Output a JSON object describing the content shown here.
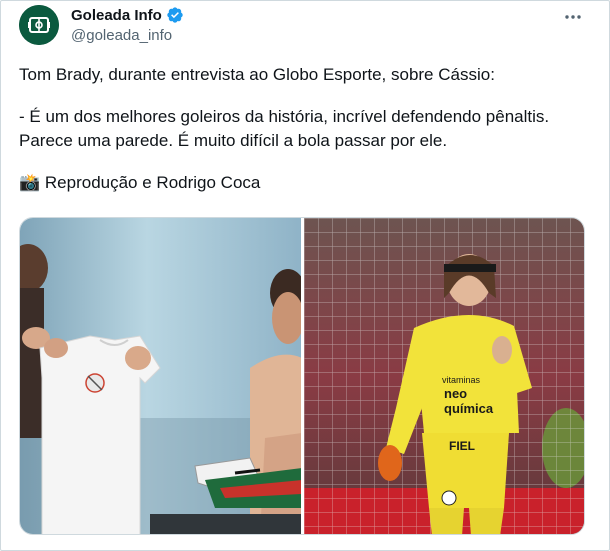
{
  "author": {
    "display_name": "Goleada Info",
    "handle": "@goleada_info",
    "avatar_icon": "goleada-logo-icon",
    "verified_icon": "verified-badge-icon",
    "verified_color": "#1d9bf0"
  },
  "more_icon": "more-dots-icon",
  "tweet": {
    "line1": "Tom Brady, durante entrevista ao Globo Esporte, sobre Cássio:",
    "line2": "- É um dos melhores goleiros da história, incrível defendendo pênaltis.",
    "line3": "Parece uma parede. É muito difícil a bola passar por ele.",
    "credit": "📸 Reprodução e Rodrigo Coca"
  },
  "media": {
    "photos": [
      {
        "name": "interview-photo",
        "jersey_text": ""
      },
      {
        "name": "goalkeeper-photo",
        "shirt_text_1": "vitaminas",
        "shirt_text_2": "neo",
        "shirt_text_3": "química",
        "shirt_text_4": "FIEL"
      }
    ]
  },
  "colors": {
    "text": "#0f1419",
    "secondary": "#536471",
    "border": "#cfd9de",
    "goalkeeper_kit": "#f2e33a"
  }
}
